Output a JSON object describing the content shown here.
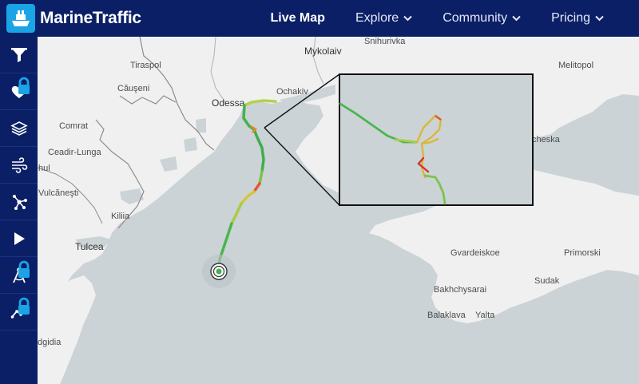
{
  "brand": {
    "name": "MarineTraffic"
  },
  "nav": {
    "items": [
      {
        "label": "Live Map",
        "active": true,
        "dropdown": false
      },
      {
        "label": "Explore",
        "active": false,
        "dropdown": true
      },
      {
        "label": "Community",
        "active": false,
        "dropdown": true
      },
      {
        "label": "Pricing",
        "active": false,
        "dropdown": true
      }
    ]
  },
  "sidebar": {
    "buttons": [
      {
        "icon": "filter-icon",
        "locked": false
      },
      {
        "icon": "heart-icon",
        "locked": true
      },
      {
        "icon": "layers-icon",
        "locked": false
      },
      {
        "icon": "wind-icon",
        "locked": false
      },
      {
        "icon": "network-icon",
        "locked": false
      },
      {
        "icon": "play-icon",
        "locked": false
      },
      {
        "icon": "compass-measure-icon",
        "locked": true
      },
      {
        "icon": "chart-line-icon",
        "locked": true
      }
    ]
  },
  "map": {
    "labels": {
      "mykolaiv": "Mykolaiv",
      "snihurivka": "Snihurivka",
      "melitopol": "Melitopol",
      "tiraspol": "Tiraspol",
      "causeni": "Căuşeni",
      "odessa": "Odessa",
      "ochakiv": "Ochakiv",
      "comrat": "Comrat",
      "ceadir_lunga": "Ceadir-Lunga",
      "hul": "hul",
      "vulcanesti": "Vulcăneşti",
      "kiliia": "Kiliia",
      "tulcea": "Tulcea",
      "cheska": "cheska",
      "gvardeiskoe": "Gvardeiskoe",
      "primorski": "Primorski",
      "bakhchysarai": "Bakhchysarai",
      "sudak": "Sudak",
      "balaklava": "Balaklava",
      "yalta": "Yalta",
      "dgidia": "dgidia"
    },
    "colors": {
      "sea": "#cbd3d6",
      "land": "#f0f0f0",
      "border": "#8c8c8c",
      "track_green": "#32b44a",
      "track_yellow": "#d9c83a",
      "track_red": "#d23a2a",
      "header": "#0b1f66"
    }
  }
}
